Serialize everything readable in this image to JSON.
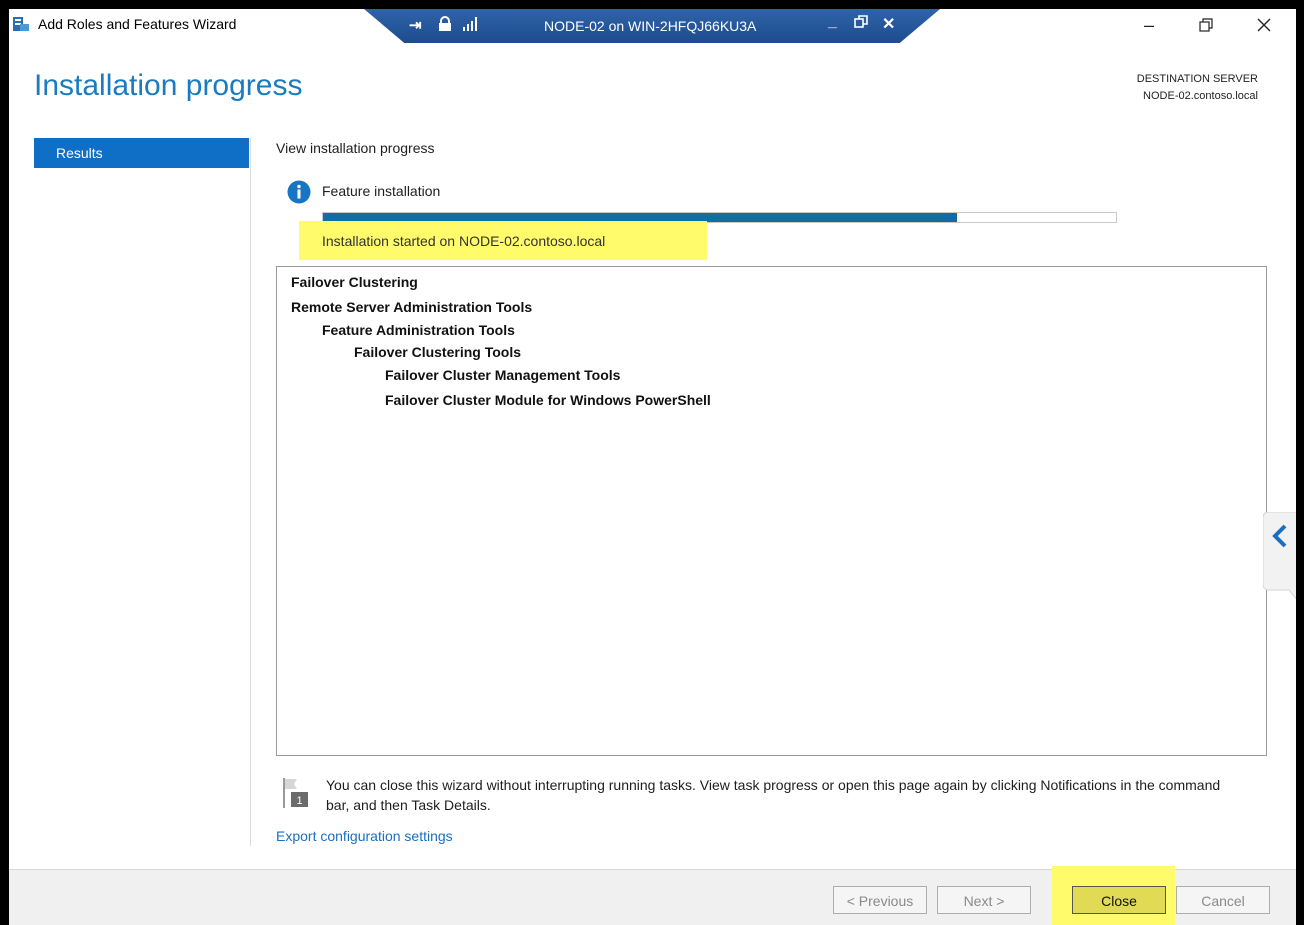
{
  "window": {
    "title": "Add Roles and Features Wizard",
    "remote_title": "NODE-02 on WIN-2HFQJ66KU3A"
  },
  "header": {
    "page_title": "Installation progress",
    "destination_label": "DESTINATION SERVER",
    "destination_value": "NODE-02.contoso.local"
  },
  "nav": {
    "items": [
      {
        "label": "Results",
        "selected": true
      }
    ]
  },
  "content": {
    "subtitle": "View installation progress",
    "feature_title": "Feature installation",
    "progress_percent": 80,
    "status_text": "Installation started on NODE-02.contoso.local",
    "features": [
      {
        "label": "Failover Clustering",
        "level": 0
      },
      {
        "label": "Remote Server Administration Tools",
        "level": 0
      },
      {
        "label": "Feature Administration Tools",
        "level": 1
      },
      {
        "label": "Failover Clustering Tools",
        "level": 2
      },
      {
        "label": "Failover Cluster Management Tools",
        "level": 3
      },
      {
        "label": "Failover Cluster Module for Windows PowerShell",
        "level": 3
      }
    ],
    "note": "You can close this wizard without interrupting running tasks. View task progress or open this page again by clicking Notifications in the command bar, and then Task Details.",
    "export_link": "Export configuration settings"
  },
  "footer": {
    "previous": "< Previous",
    "next": "Next >",
    "close": "Close",
    "cancel": "Cancel"
  },
  "colors": {
    "accent": "#1a7bbf",
    "nav_selected": "#0f6fc6",
    "progress": "#0f6fa0",
    "highlight": "#fffb6b"
  }
}
